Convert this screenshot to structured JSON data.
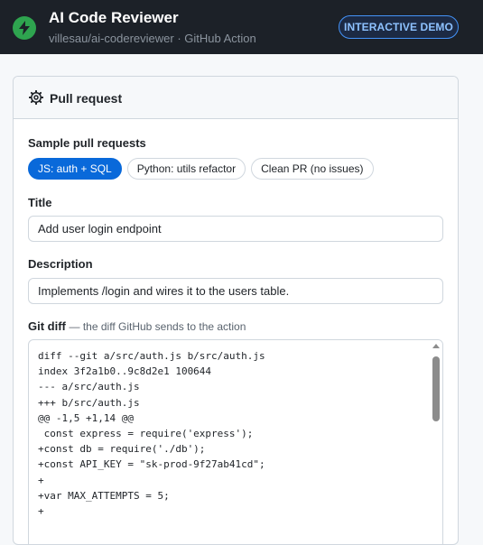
{
  "header": {
    "title": "AI Code Reviewer",
    "subtitle": "villesau/ai-codereviewer · GitHub Action",
    "badge": "INTERACTIVE DEMO",
    "logo_icon": "lightning-bolt-icon",
    "bg_color": "#1c2128",
    "accent_color": "#2ea44f"
  },
  "panel": {
    "title": "Pull request",
    "icon": "gear-icon"
  },
  "samples": {
    "label": "Sample pull requests",
    "options": [
      {
        "label": "JS: auth + SQL",
        "active": true
      },
      {
        "label": "Python: utils refactor",
        "active": false
      },
      {
        "label": "Clean PR (no issues)",
        "active": false
      }
    ]
  },
  "title_field": {
    "label": "Title",
    "value": "Add user login endpoint"
  },
  "description_field": {
    "label": "Description",
    "value": "Implements /login and wires it to the users table."
  },
  "diff_field": {
    "label": "Git diff",
    "hint": "— the diff GitHub sends to the action",
    "value": "diff --git a/src/auth.js b/src/auth.js\nindex 3f2a1b0..9c8d2e1 100644\n--- a/src/auth.js\n+++ b/src/auth.js\n@@ -1,5 +1,14 @@\n const express = require('express');\n+const db = require('./db');\n+const API_KEY = \"sk-prod-9f27ab41cd\";\n+\n+var MAX_ATTEMPTS = 5;\n+"
  }
}
